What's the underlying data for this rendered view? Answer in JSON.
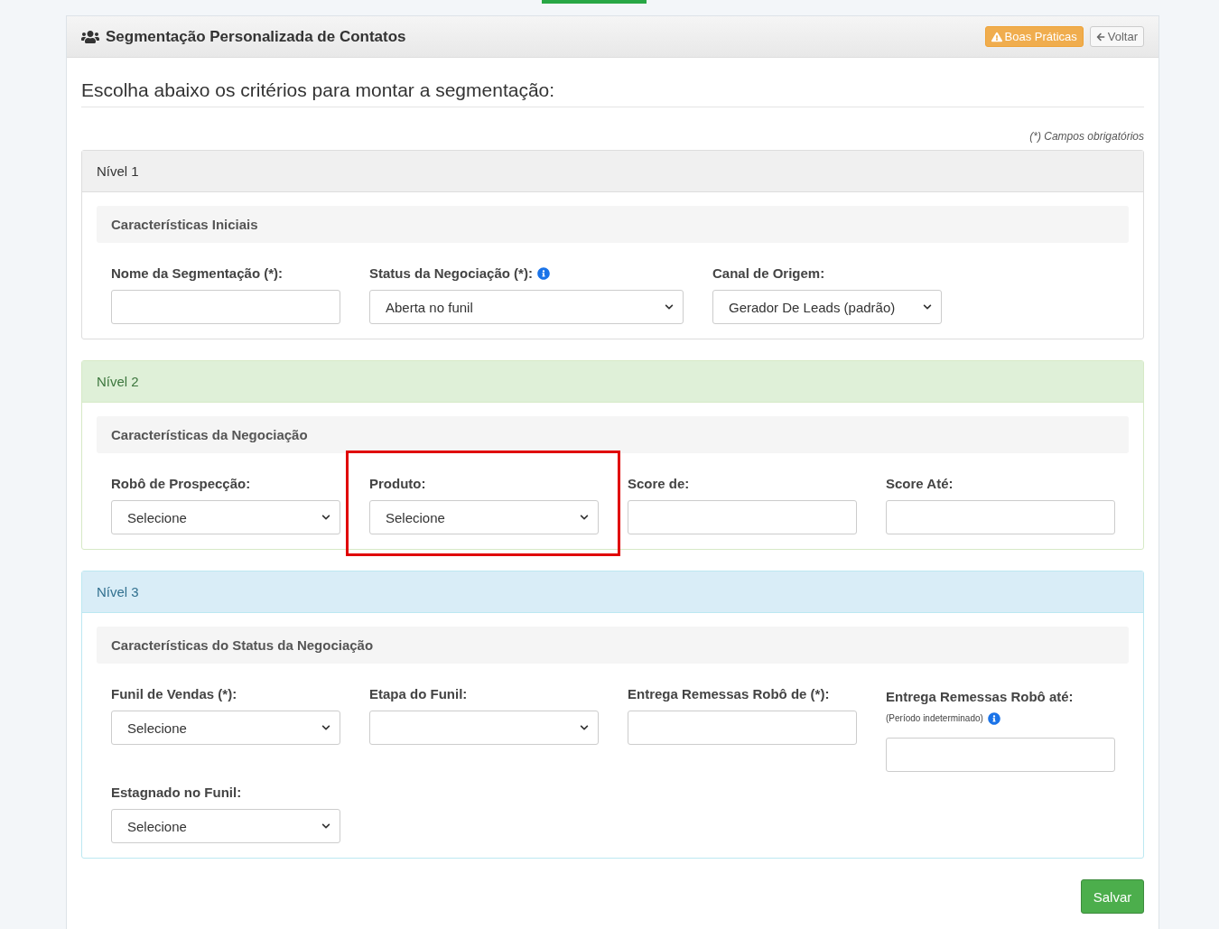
{
  "header": {
    "title": "Segmentação Personalizada de Contatos",
    "buttons": [
      {
        "label": "Boas Práticas",
        "kind": "warning"
      },
      {
        "label": "Voltar",
        "kind": "back"
      }
    ]
  },
  "heading": "Escolha abaixo os critérios para montar a segmentação:",
  "required_note": "(*) Campos obrigatórios",
  "levels": [
    {
      "title": "Nível 1",
      "kind": "default",
      "subtitle": "Características Iniciais",
      "fields": [
        {
          "label": "Nome da Segmentação (*):",
          "kind": "text",
          "highlighted": false
        },
        {
          "label": "Status da Negociação (*):",
          "kind": "select",
          "value": "Aberta no funil",
          "info": true,
          "highlighted": false
        },
        {
          "label": "Canal de Origem:",
          "kind": "select",
          "value": "Gerador De Leads (padrão)",
          "highlighted": false
        }
      ]
    },
    {
      "title": "Nível 2",
      "kind": "success",
      "subtitle": "Características da Negociação",
      "fields": [
        {
          "label": "Robô de Prospecção:",
          "kind": "select",
          "value": "Selecione",
          "highlighted": false
        },
        {
          "label": "Produto:",
          "kind": "select",
          "value": "Selecione",
          "highlighted": true
        },
        {
          "label": "Score de:",
          "kind": "text",
          "highlighted": false
        },
        {
          "label": "Score Até:",
          "kind": "text",
          "highlighted": false
        }
      ]
    },
    {
      "title": "Nível 3",
      "kind": "info",
      "subtitle": "Características do Status da Negociação",
      "fields": [
        {
          "label": "Funil de Vendas (*):",
          "kind": "select",
          "value": "Selecione",
          "highlighted": false
        },
        {
          "label": "Etapa do Funil:",
          "kind": "select",
          "highlighted": false
        },
        {
          "label": "Entrega Remessas Robô de (*):",
          "kind": "text",
          "highlighted": false
        },
        {
          "label": "Entrega Remessas Robô até:",
          "kind": "text",
          "note": "(Período indeterminado)",
          "info": true,
          "highlighted": false
        },
        {
          "label": "Estagnado no Funil:",
          "kind": "select",
          "value": "Selecione",
          "highlighted": false
        }
      ]
    }
  ],
  "save_button": "Salvar"
}
